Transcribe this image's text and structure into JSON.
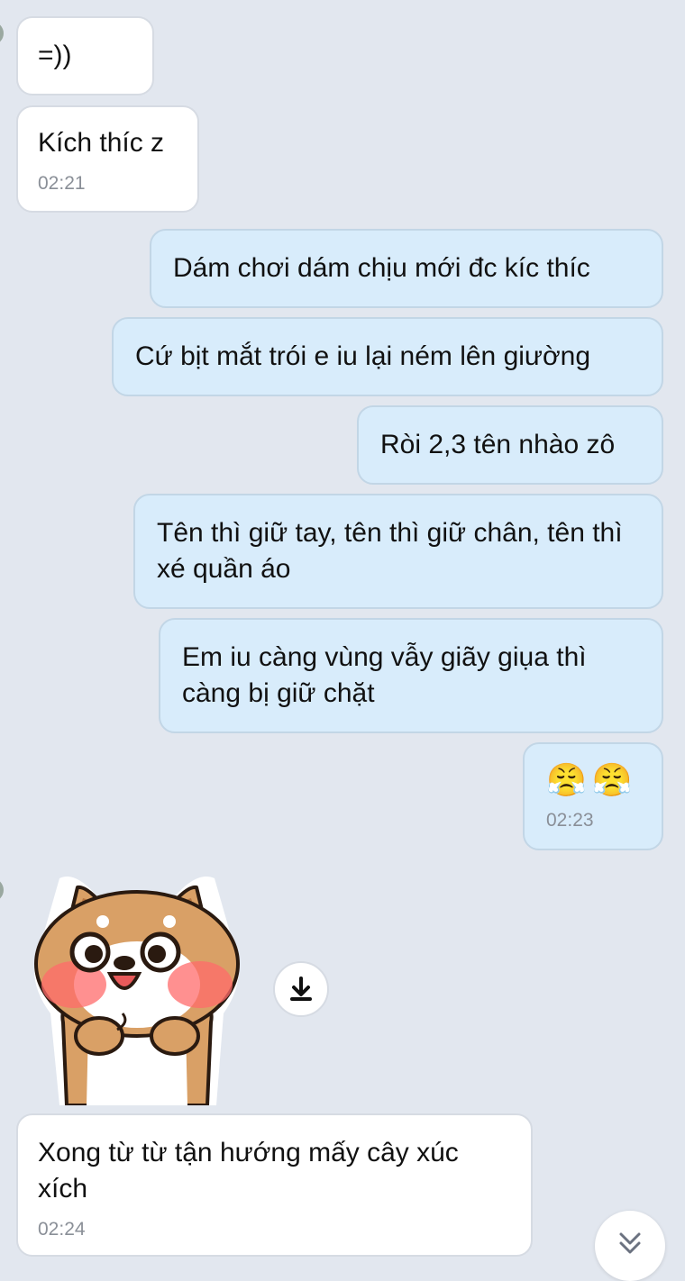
{
  "messages": [
    {
      "text": "=))"
    },
    {
      "text": "Kích thíc z",
      "time": "02:21"
    },
    {
      "text": "Dám chơi dám chịu mới đc kíc thíc"
    },
    {
      "text": "Cứ bịt mắt trói e iu lại ném lên giường"
    },
    {
      "text": "Ròi 2,3 tên nhào zô"
    },
    {
      "text": "Tên thì giữ tay, tên thì giữ chân, tên thì xé quần áo"
    },
    {
      "text": "Em iu càng vùng vẫy giãy giụa thì càng bị giữ chặt"
    },
    {
      "text": "😤😤",
      "time": "02:23"
    },
    {
      "text": "Xong từ từ tận hướng mấy cây xúc xích",
      "time": "02:24"
    }
  ],
  "sticker": {
    "name": "shiba-dog-blushing-sticker"
  },
  "icons": {
    "download": "download-icon",
    "scroll": "double-chevron-down-icon"
  },
  "colors": {
    "background": "#e2e7ef",
    "incoming": "#ffffff",
    "outgoing": "#d8ecfb"
  }
}
